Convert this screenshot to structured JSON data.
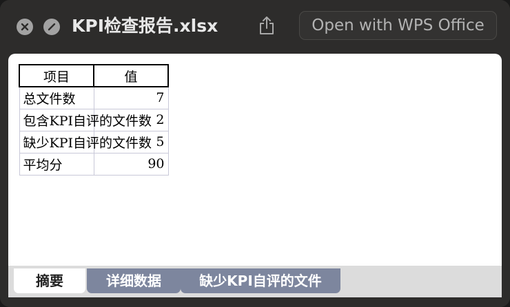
{
  "window": {
    "title": "KPI检查报告.xlsx",
    "open_with_label": "Open with WPS Office"
  },
  "table": {
    "headers": [
      "项目",
      "值"
    ],
    "rows": [
      {
        "label": "总文件数",
        "value": "7"
      },
      {
        "label": "包含KPI自评的文件数",
        "value": "2"
      },
      {
        "label": "缺少KPI自评的文件数",
        "value": "5"
      },
      {
        "label": "平均分",
        "value": "90"
      }
    ]
  },
  "sheet_tabs": [
    {
      "label": "摘要",
      "active": true
    },
    {
      "label": "详细数据",
      "active": false
    },
    {
      "label": "缺少KPI自评的文件",
      "active": false
    }
  ],
  "icons": {
    "close": "close-circle-icon",
    "minimize": "minus-circle-icon",
    "share": "share-icon"
  },
  "colors": {
    "titlebar": "#2d2c2b",
    "inactive_tab": "#7d869e",
    "sheet_background": "#ffffff"
  }
}
